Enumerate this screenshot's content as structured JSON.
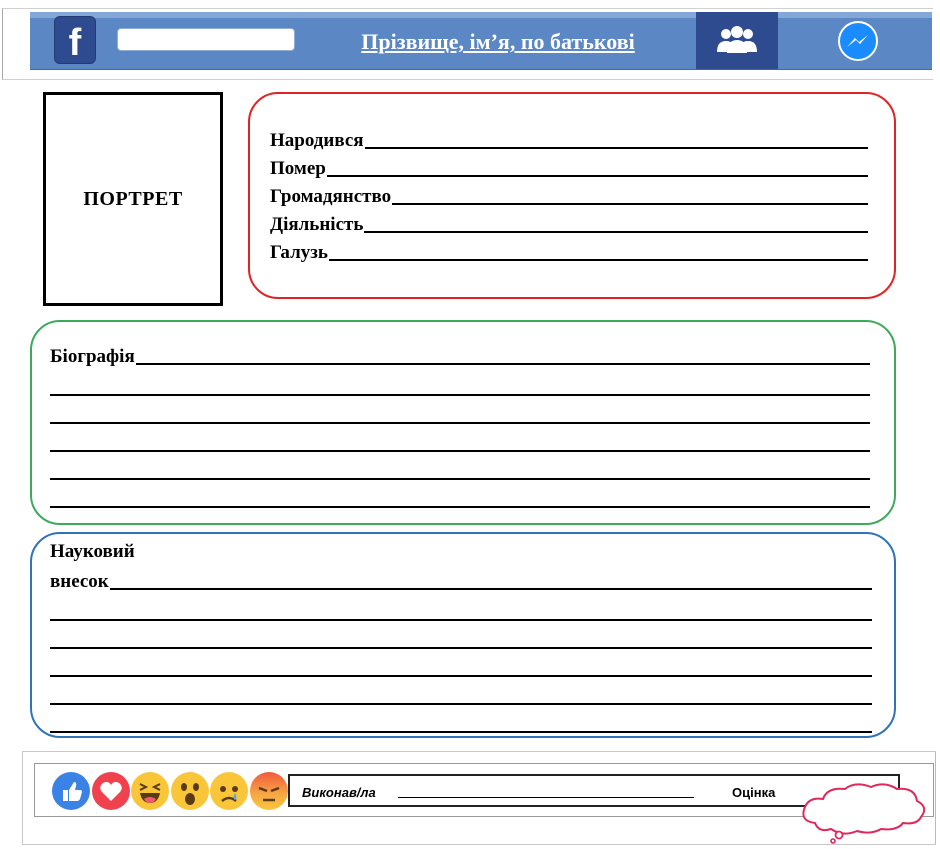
{
  "header": {
    "title": "Прізвище, ім’я, по батькові",
    "search": {
      "value": "",
      "placeholder": ""
    },
    "icons": [
      "facebook-logo",
      "friends-icon",
      "messenger-icon"
    ],
    "colors": {
      "bar": "#5b88c4",
      "dark": "#2e4b8f",
      "messenger": "#1a8cff"
    }
  },
  "portrait": {
    "label": "ПОРТРЕТ"
  },
  "info": {
    "border_color": "#e02424",
    "fields": [
      {
        "label": "Народився"
      },
      {
        "label": "Помер"
      },
      {
        "label": "Громадянство"
      },
      {
        "label": "Діяльність"
      },
      {
        "label": "Галузь"
      }
    ]
  },
  "biography": {
    "label": "Біографія",
    "border_color": "#3daa5b"
  },
  "science": {
    "label_line1": "Науковий",
    "label_line2": "внесок",
    "border_color": "#2f73b9"
  },
  "footer": {
    "reactions": [
      "like",
      "love",
      "haha",
      "wow",
      "sad",
      "angry"
    ],
    "done_label": "Виконав/ла",
    "grade_label": "Оцінка"
  }
}
